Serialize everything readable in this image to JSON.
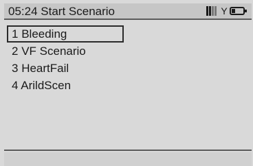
{
  "header": {
    "time": "05:24",
    "title": "Start Scenario",
    "battery_level_fraction": 0.3
  },
  "menu": {
    "selected_index": 0,
    "items": [
      {
        "number": "1",
        "label": "Bleeding"
      },
      {
        "number": "2",
        "label": "VF Scenario"
      },
      {
        "number": "3",
        "label": "HeartFail"
      },
      {
        "number": "4",
        "label": "ArildScen"
      }
    ]
  },
  "icons": {
    "signal": "signal-strength-icon",
    "antenna": "antenna-icon",
    "battery": "battery-icon"
  }
}
